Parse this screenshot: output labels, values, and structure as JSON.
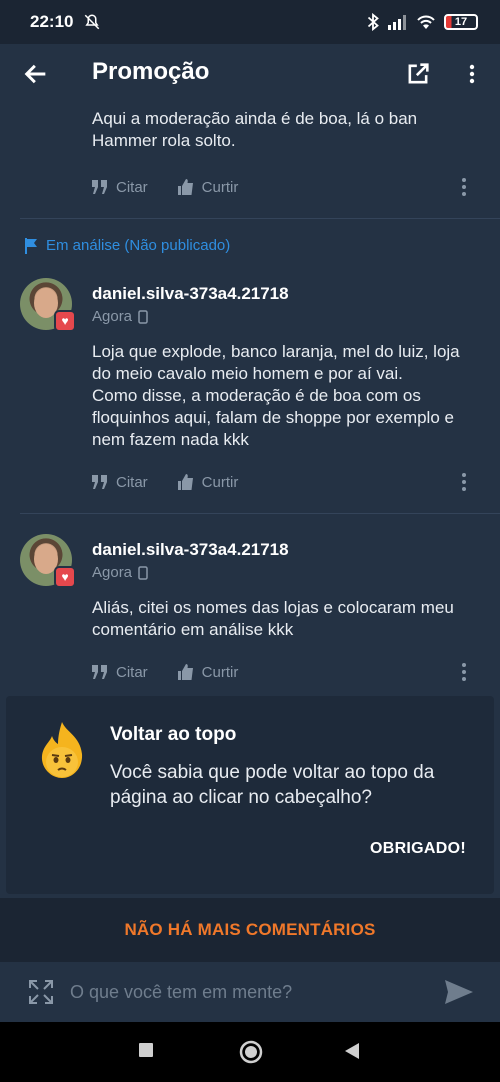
{
  "status_bar": {
    "time": "22:10",
    "battery": "17"
  },
  "app_bar": {
    "title": "Promoção"
  },
  "top_comment": {
    "text": "Aqui a moderação ainda é de boa, lá o ban Hammer rola solto."
  },
  "actions": {
    "quote_label": "Citar",
    "like_label": "Curtir"
  },
  "moderation_notice": "Em análise (Não publicado)",
  "comments": [
    {
      "username": "daniel.silva-373a4.21718",
      "time": "Agora",
      "text": "Loja que explode, banco laranja, mel do luiz, loja do meio cavalo meio homem e por aí vai.\nComo disse, a moderação é de boa com os floquinhos aqui, falam de shoppe por exemplo e nem fazem nada kkk"
    },
    {
      "username": "daniel.silva-373a4.21718",
      "time": "Agora",
      "text": "Aliás, citei os nomes das lojas e colocaram meu comentário em análise kkk"
    }
  ],
  "tip_card": {
    "title": "Voltar ao topo",
    "body": "Você sabia que pode voltar ao topo da página ao clicar no cabeçalho?",
    "button": "OBRIGADO!"
  },
  "footer": {
    "no_more": "NÃO HÁ MAIS COMENTÁRIOS"
  },
  "composer": {
    "placeholder": "O que você tem em mente?"
  },
  "colors": {
    "accent": "#f0782a",
    "link": "#2f8ee0",
    "background": "#243244"
  }
}
